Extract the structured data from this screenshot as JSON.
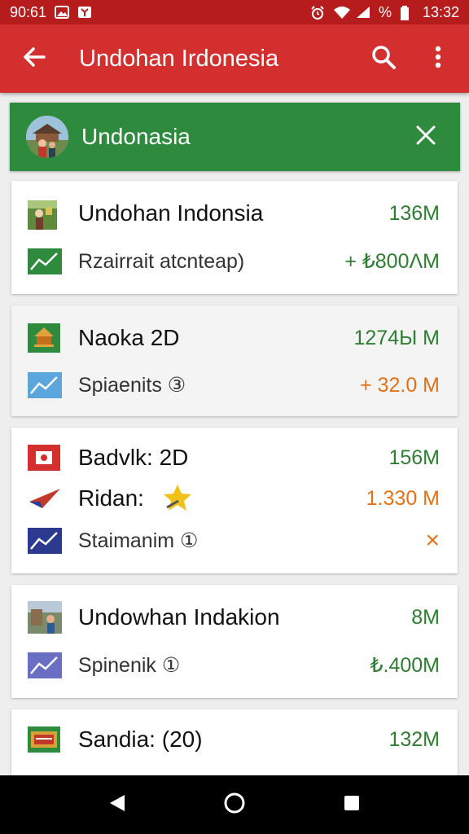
{
  "status_bar": {
    "time_left": "90:61",
    "battery_text": "%",
    "time_right": "13:32"
  },
  "app_bar": {
    "title": "Undohan Irdonesia",
    "icons": [
      "back-arrow-icon",
      "search-icon",
      "more-vert-icon"
    ]
  },
  "filter_chip": {
    "label": "Undonasia",
    "icons": [
      "avatar-photo",
      "close-icon"
    ]
  },
  "cards": [
    {
      "rows": [
        {
          "label": "Undohan Indonsia",
          "value": "136M",
          "value_color": "green",
          "icon": "flag-photo-icon"
        },
        {
          "label": "Rzairrait atcnteap)",
          "value": "+ ₺800ΛM",
          "value_color": "green",
          "icon": "trend-chart-green-icon"
        }
      ]
    },
    {
      "rows": [
        {
          "label": "Naoka 2D",
          "value": "1274Ы M",
          "value_color": "green",
          "icon": "temple-green-icon"
        },
        {
          "label": "Spiaenits ③",
          "value": "+ 32.0 M",
          "value_color": "orange",
          "icon": "trend-chart-blue-icon"
        }
      ]
    },
    {
      "rows": [
        {
          "label": "Badvlk: 2D",
          "value": "156M",
          "value_color": "green",
          "icon": "flag-red-icon"
        },
        {
          "label": "Ridan:",
          "value": "1.330 M",
          "value_color": "orange",
          "icon": "plane-icon"
        },
        {
          "label": "Staimanim ①",
          "value": "×",
          "value_color": "orange",
          "icon": "trend-chart-navy-icon"
        }
      ]
    },
    {
      "rows": [
        {
          "label": "Undowhan Indakion",
          "value": "8M",
          "value_color": "green",
          "icon": "street-photo-icon"
        },
        {
          "label": "Spinenik ①",
          "value": "₺.400M",
          "value_color": "green",
          "icon": "trend-chart-purple-icon"
        }
      ]
    },
    {
      "rows": [
        {
          "label": "Sandia: (20)",
          "value": "132M",
          "value_color": "green",
          "icon": "flag-building-icon"
        }
      ]
    }
  ],
  "nav_bar": {
    "icons": [
      "back-triangle-icon",
      "home-circle-icon",
      "recents-square-icon"
    ]
  },
  "colors": {
    "app_bar": "#d32f2f",
    "status_bar": "#b71c1c",
    "chip": "#2e8b3e",
    "value_green": "#2e7d32",
    "value_orange": "#e0731a"
  }
}
